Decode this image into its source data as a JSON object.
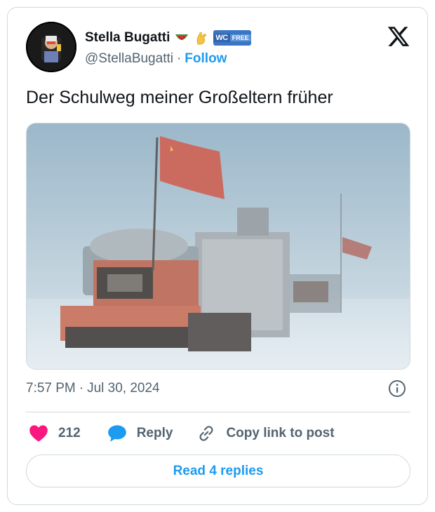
{
  "author": {
    "name": "Stella Bugatti",
    "handle": "@StellaBugatti",
    "separator": "·",
    "follow_label": "Follow",
    "badges": [
      "watermelon-emoji",
      "pinching-hand-emoji",
      "wc-free-badge"
    ],
    "wc_badge": {
      "left": "WC",
      "right": "FREE"
    }
  },
  "tweet": {
    "text": "Der Schulweg meiner Großeltern früher",
    "time": "7:57 PM",
    "date": "Jul 30, 2024",
    "separator": "·"
  },
  "actions": {
    "likes_count": "212",
    "reply_label": "Reply",
    "copy_label": "Copy link to post"
  },
  "footer": {
    "read_replies_label": "Read 4 replies"
  },
  "icons": {
    "brand": "x-logo-icon",
    "like": "heart-icon",
    "reply": "speech-bubble-icon",
    "copy": "link-icon",
    "info": "info-icon"
  },
  "colors": {
    "accent": "#1d9bf0",
    "like": "#f91880",
    "muted_text": "#536471",
    "border": "#cfd9de"
  }
}
